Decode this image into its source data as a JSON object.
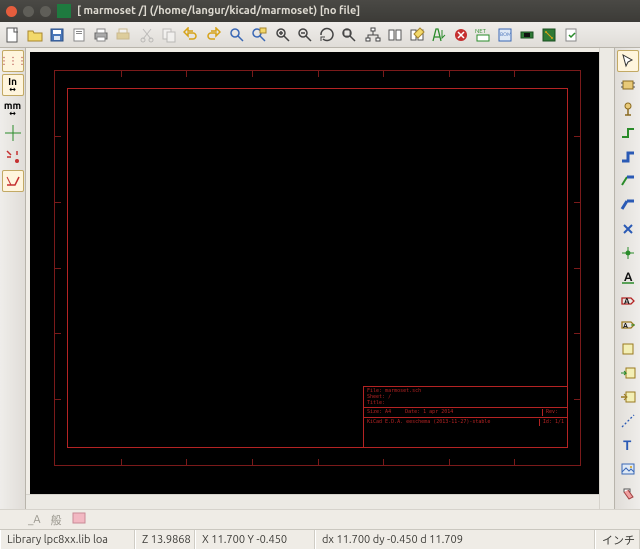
{
  "window": {
    "title": "[ marmoset /] (/home/langur/kicad/marmoset) [no file]"
  },
  "left_toolbar": {
    "grid_label": "⋮⋮⋮",
    "units_in": "In",
    "units_mm": "mm"
  },
  "title_block": {
    "file": "File: marmoset.sch",
    "sheet": "Sheet: /",
    "title": "Title:",
    "size": "Size: A4",
    "date": "Date: 1 apr 2014",
    "rev": "Rev:",
    "kicad": "KiCad E.D.A.  eeschema  (2013-11-27)-stable",
    "id": "Id: 1/1"
  },
  "ime": {
    "label_a": "_A",
    "label_mode": "般"
  },
  "status": {
    "library": "Library lpc8xx.lib loa",
    "z": "Z 13.9868",
    "xy": "X 11.700  Y -0.450",
    "dxy": "dx 11.700  dy -0.450  d 11.709",
    "unit": "インチ"
  }
}
